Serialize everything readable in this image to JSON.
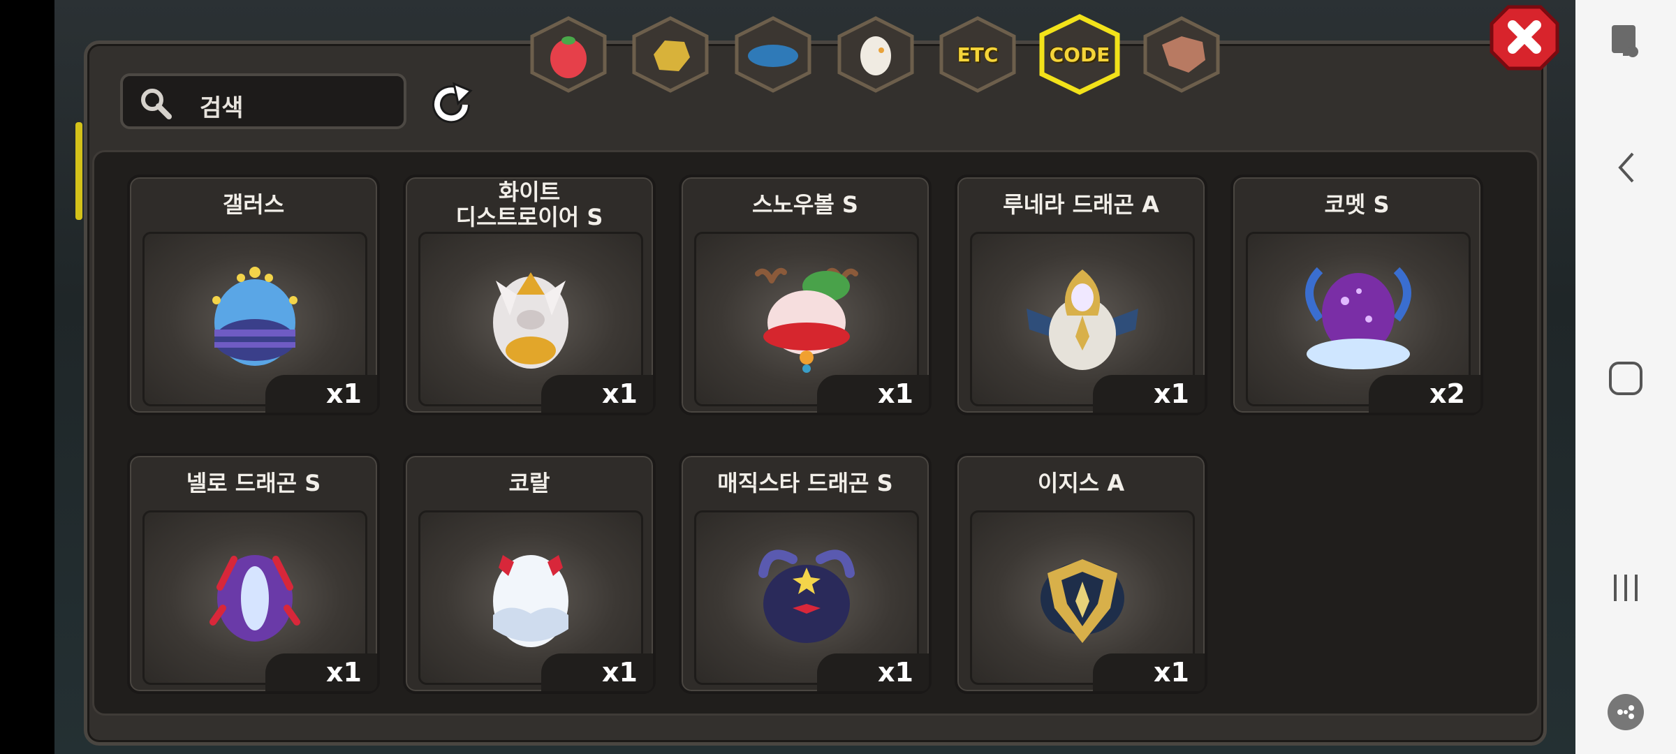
{
  "search": {
    "placeholder": "검색"
  },
  "tabs": [
    {
      "id": "fruit",
      "icon": "fruit-icon",
      "label": ""
    },
    {
      "id": "ore",
      "icon": "ore-icon",
      "label": ""
    },
    {
      "id": "scale",
      "icon": "dragon-scale-icon",
      "label": ""
    },
    {
      "id": "egg",
      "icon": "egg-icon",
      "label": ""
    },
    {
      "id": "etc",
      "icon": "etc-icon",
      "label": "ETC"
    },
    {
      "id": "code",
      "icon": "code-icon",
      "label": "CODE",
      "selected": true
    },
    {
      "id": "beast",
      "icon": "dragon-head-icon",
      "label": ""
    }
  ],
  "items": [
    {
      "name": "갤러스",
      "qty": "x1",
      "icon": "gallus-egg"
    },
    {
      "name": "화이트\n디스트로이어 S",
      "qty": "x1",
      "icon": "white-destroyer-egg"
    },
    {
      "name": "스노우볼 S",
      "qty": "x1",
      "icon": "snowball-egg"
    },
    {
      "name": "루네라 드래곤 A",
      "qty": "x1",
      "icon": "lunera-dragon-egg"
    },
    {
      "name": "코멧 S",
      "qty": "x2",
      "icon": "comet-egg"
    },
    {
      "name": "넬로 드래곤 S",
      "qty": "x1",
      "icon": "nello-dragon-egg"
    },
    {
      "name": "코랄",
      "qty": "x1",
      "icon": "coral-egg"
    },
    {
      "name": "매직스타 드래곤 S",
      "qty": "x1",
      "icon": "magicstar-dragon-egg"
    },
    {
      "name": "이지스 A",
      "qty": "x1",
      "icon": "aegis-egg"
    }
  ],
  "colors": {
    "selected_tab_border": "#f2e21a",
    "close_red": "#d8242c",
    "panel": "#33302d"
  }
}
